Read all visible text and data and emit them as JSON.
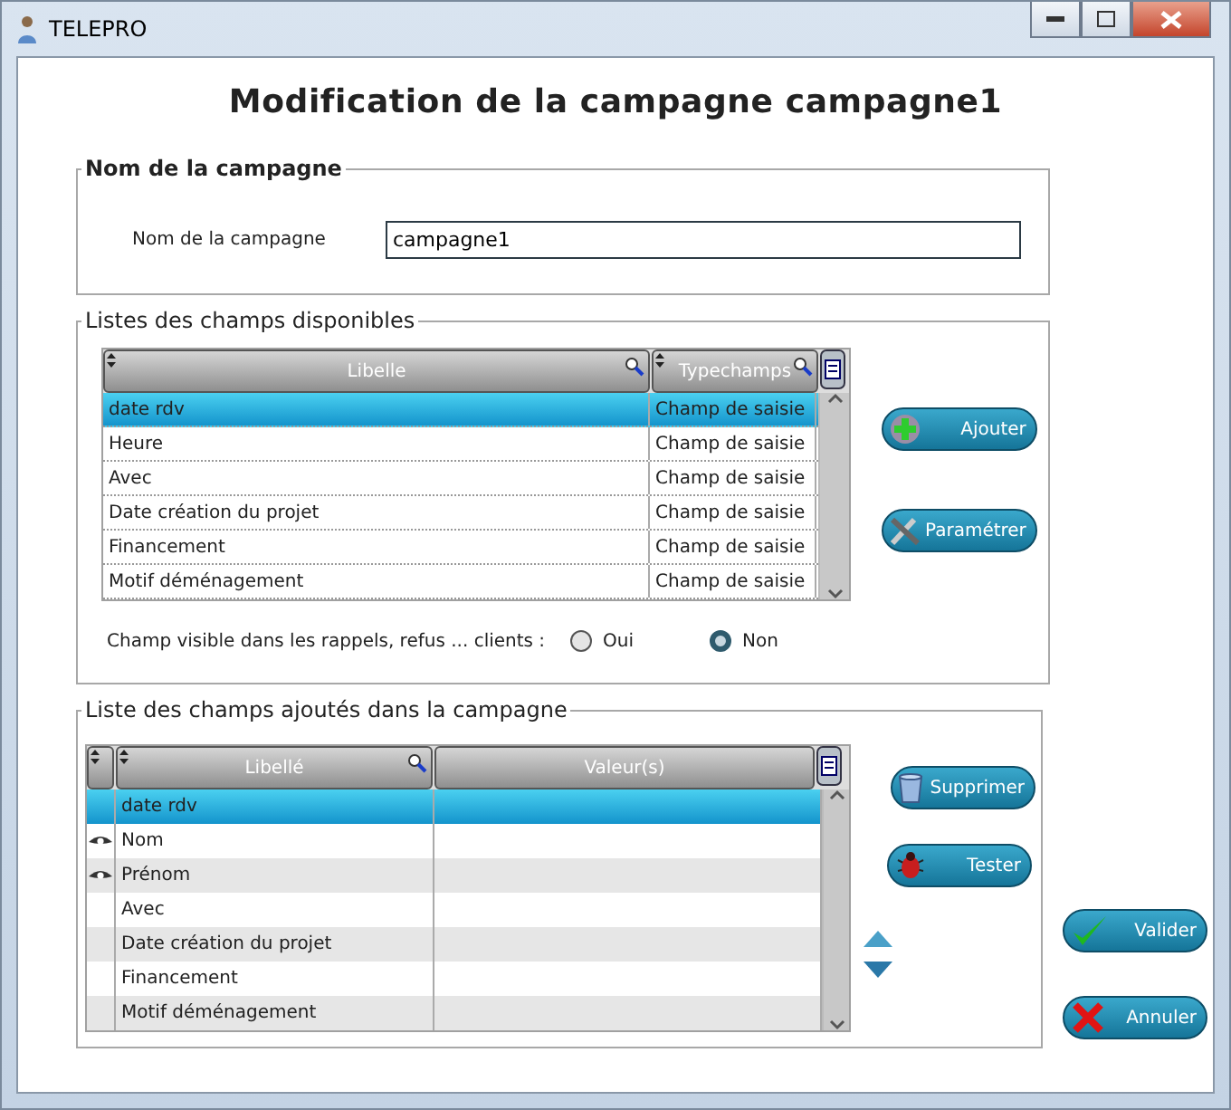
{
  "window": {
    "title": "TELEPRO"
  },
  "heading": "Modification de la campagne campagne1",
  "name_group": {
    "legend": "Nom de la campagne",
    "label": "Nom de la campagne",
    "value": "campagne1"
  },
  "available_group": {
    "legend": "Listes des champs disponibles",
    "columns": [
      "Libelle",
      "Typechamps"
    ],
    "rows": [
      {
        "cells": [
          "date rdv",
          "Champ de saisie"
        ],
        "selected": true
      },
      {
        "cells": [
          "Heure",
          "Champ de saisie"
        ],
        "selected": false
      },
      {
        "cells": [
          "Avec",
          "Champ de saisie"
        ],
        "selected": false
      },
      {
        "cells": [
          "Date création du projet",
          "Champ de saisie"
        ],
        "selected": false
      },
      {
        "cells": [
          "Financement",
          "Champ de saisie"
        ],
        "selected": false
      },
      {
        "cells": [
          "Motif déménagement",
          "Champ de saisie"
        ],
        "selected": false
      }
    ],
    "buttons": [
      {
        "label": "Ajouter",
        "kind": "add"
      },
      {
        "label": "Paramétrer",
        "kind": "tools"
      }
    ],
    "visibility": {
      "label": "Champ visible dans les rappels, refus ... clients :",
      "options": [
        {
          "label": "Oui",
          "selected": false
        },
        {
          "label": "Non",
          "selected": true
        }
      ]
    }
  },
  "added_group": {
    "legend": "Liste des champs ajoutés dans la campagne",
    "columns": [
      "Libellé",
      "Valeur(s)"
    ],
    "rows": [
      {
        "cells": [
          "date rdv",
          ""
        ],
        "selected": true,
        "eye": false
      },
      {
        "cells": [
          "Nom",
          ""
        ],
        "selected": false,
        "eye": true
      },
      {
        "cells": [
          "Prénom",
          ""
        ],
        "selected": false,
        "eye": true
      },
      {
        "cells": [
          "Avec",
          ""
        ],
        "selected": false,
        "eye": false
      },
      {
        "cells": [
          "Date création du projet",
          ""
        ],
        "selected": false,
        "eye": false
      },
      {
        "cells": [
          "Financement",
          ""
        ],
        "selected": false,
        "eye": false
      },
      {
        "cells": [
          "Motif déménagement",
          ""
        ],
        "selected": false,
        "eye": false
      }
    ],
    "buttons": [
      {
        "label": "Supprimer",
        "kind": "trash"
      },
      {
        "label": "Tester",
        "kind": "bug"
      }
    ]
  },
  "actions": [
    {
      "label": "Valider",
      "kind": "check"
    },
    {
      "label": "Annuler",
      "kind": "cross"
    }
  ]
}
